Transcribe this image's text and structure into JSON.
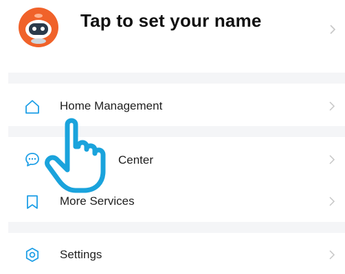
{
  "profile": {
    "name_prompt": "Tap to set your name",
    "avatar_icon": "robot-avatar-icon"
  },
  "menu": {
    "items": [
      {
        "label": "Home Management",
        "icon": "home-icon"
      },
      {
        "label": "Center",
        "icon": "message-icon"
      },
      {
        "label": "More Services",
        "icon": "bookmark-icon"
      },
      {
        "label": "Settings",
        "icon": "settings-icon"
      }
    ]
  },
  "colors": {
    "accent": "#1e9fe6",
    "separator": "#f4f5f7",
    "avatar_orange": "#f0622a",
    "hand_outline": "#1aa3dc"
  }
}
